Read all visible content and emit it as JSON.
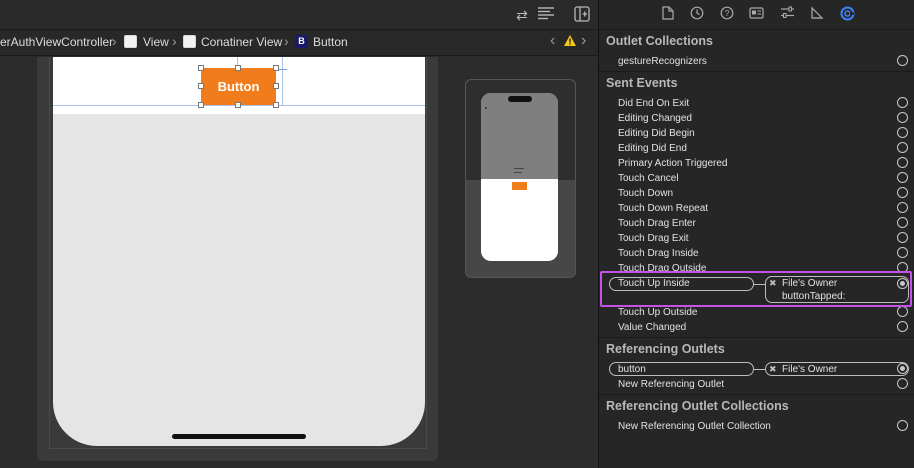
{
  "breadcrumb": {
    "items": [
      "erAuthViewController",
      "View",
      "Conatiner View",
      "Button"
    ],
    "badge_letter": "B"
  },
  "canvas": {
    "button_label": "Button"
  },
  "inspector": {
    "outlet_collections": {
      "title": "Outlet Collections",
      "items": [
        {
          "label": "gestureRecognizers",
          "connected": false
        }
      ]
    },
    "sent_events": {
      "title": "Sent Events",
      "items": [
        {
          "label": "Did End On Exit",
          "connected": false
        },
        {
          "label": "Editing Changed",
          "connected": false
        },
        {
          "label": "Editing Did Begin",
          "connected": false
        },
        {
          "label": "Editing Did End",
          "connected": false
        },
        {
          "label": "Primary Action Triggered",
          "connected": false
        },
        {
          "label": "Touch Cancel",
          "connected": false
        },
        {
          "label": "Touch Down",
          "connected": false
        },
        {
          "label": "Touch Down Repeat",
          "connected": false
        },
        {
          "label": "Touch Drag Enter",
          "connected": false
        },
        {
          "label": "Touch Drag Exit",
          "connected": false
        },
        {
          "label": "Touch Drag Inside",
          "connected": false
        },
        {
          "label": "Touch Drag Outside",
          "connected": false
        },
        {
          "label": "Touch Up Inside",
          "connected": true,
          "target": "File's Owner",
          "action": "buttonTapped:"
        },
        {
          "label": "Touch Up Outside",
          "connected": false
        },
        {
          "label": "Value Changed",
          "connected": false
        }
      ]
    },
    "referencing_outlets": {
      "title": "Referencing Outlets",
      "items": [
        {
          "label": "button",
          "connected": true,
          "target": "File's Owner"
        },
        {
          "label": "New Referencing Outlet",
          "connected": false
        }
      ]
    },
    "referencing_outlet_collections": {
      "title": "Referencing Outlet Collections",
      "items": [
        {
          "label": "New Referencing Outlet Collection",
          "connected": false
        }
      ]
    }
  },
  "icons": {
    "toolbar": [
      "swap-arrows-icon",
      "lines-icon",
      "add-editor-icon"
    ],
    "inspector_tabs": [
      "file-icon",
      "history-icon",
      "help-icon",
      "identity-icon",
      "attributes-icon",
      "size-icon",
      "connections-icon"
    ],
    "warning": "warning-icon"
  },
  "colors": {
    "accent_button": "#f07c1b",
    "highlight": "#c452e8",
    "active_tab": "#3b82f6",
    "warning": "#f5c518"
  }
}
